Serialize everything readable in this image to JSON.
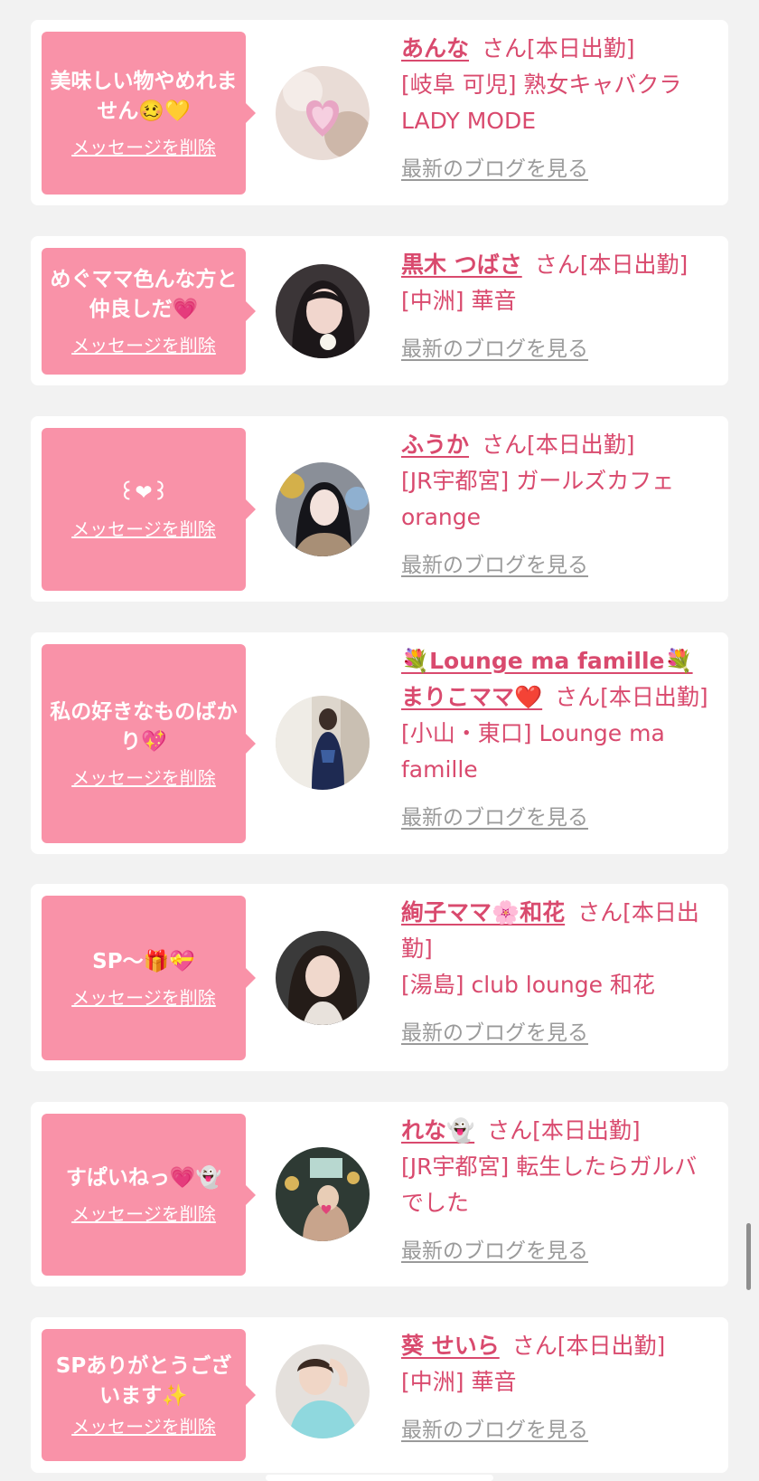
{
  "bubble_delete_label": "メッセージを削除",
  "blog_label": "最新のブログを見る",
  "items": [
    {
      "message": "美味しい物やめれません🥴💛",
      "name": "あんな",
      "status": "さん[本日出勤]",
      "shop": "[岐阜 可児] 熟女キャバクラLADY MODE"
    },
    {
      "message": "めぐママ色んな方と仲良しだ💗",
      "name": "黒木 つばさ",
      "status": "さん[本日出勤]",
      "shop": "[中洲] 華音"
    },
    {
      "message": "꒰❤︎꒱",
      "name": "ふうか",
      "status": "さん[本日出勤]",
      "shop": "[JR宇都宮] ガールズカフェorange"
    },
    {
      "message": "私の好きなものばかり💖",
      "name": "💐Lounge ma famille💐まりこママ❤️",
      "status": "さん[本日出勤]",
      "shop": "[小山・東口] Lounge ma famille"
    },
    {
      "message": "SP〜🎁💝",
      "name": "絢子ママ🌸和花",
      "status": "さん[本日出勤]",
      "shop": "[湯島] club lounge 和花"
    },
    {
      "message": "すぱいねっ💗👻",
      "name": "れな👻",
      "status": "さん[本日出勤]",
      "shop": "[JR宇都宮] 転生したらガルバでした"
    },
    {
      "message": "SPありがとうございます✨",
      "name": "葵 せいら",
      "status": "さん[本日出勤]",
      "shop": "[中洲] 華音"
    }
  ],
  "colors": {
    "page_bg": "#f2f2f2",
    "card_bg": "#ffffff",
    "bubble_bg": "#f992a8",
    "name_text": "#d94a6e",
    "blog_link": "#9a9a9a"
  }
}
